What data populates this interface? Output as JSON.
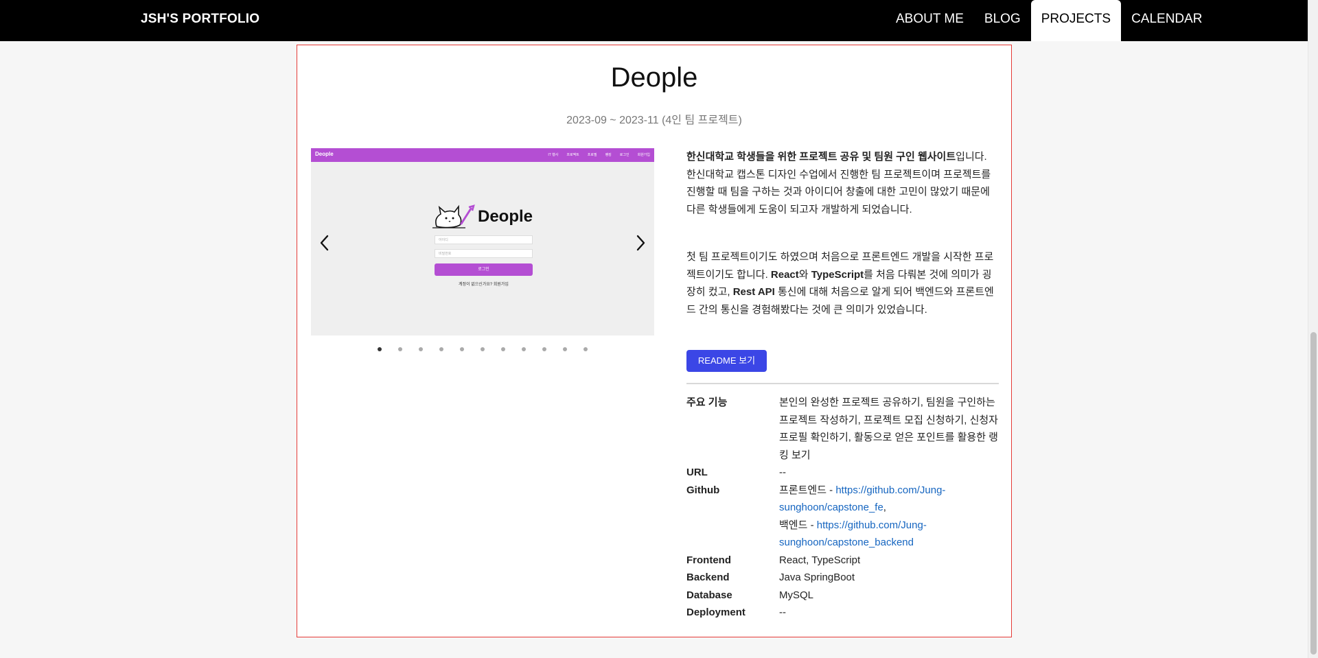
{
  "nav": {
    "brand": "JSH'S PORTFOLIO",
    "items": [
      {
        "label": "ABOUT ME",
        "active": false
      },
      {
        "label": "BLOG",
        "active": false
      },
      {
        "label": "PROJECTS",
        "active": true
      },
      {
        "label": "CALENDAR",
        "active": false
      }
    ]
  },
  "project": {
    "title": "Deople",
    "period": "2023-09 ~ 2023-11 (4인 팀 프로젝트)",
    "carousel": {
      "slide_count": 11,
      "active_index": 0,
      "screenshot": {
        "logo": "Deople",
        "menu": [
          "IT 행사",
          "프로젝트",
          "프로필",
          "랭킹",
          "로그인",
          "회원가입"
        ],
        "brand": "Deople",
        "id_placeholder": "아이디",
        "pw_placeholder": "비밀번호",
        "login_label": "로그인",
        "signup_text": "계정이 없으신가요? 회원가입",
        "accent_color": "#b44ed3"
      }
    },
    "description": {
      "p1_bold": "한신대학교 학생들을 위한 프로젝트 공유 및 팀원 구인 웹사이트",
      "p1_rest": "입니다. 한신대학교 캡스톤 디자인 수업에서 진행한 팀 프로젝트이며 프로젝트를 진행할 때 팀을 구하는 것과 아이디어 창출에 대한 고민이 많았기 때문에 다른 학생들에게 도움이 되고자 개발하게 되었습니다.",
      "p2_a": "첫 팀 프로젝트이기도 하였으며 처음으로 프론트엔드 개발을 시작한 프로젝트이기도 합니다. ",
      "p2_react": "React",
      "p2_b": "와 ",
      "p2_ts": "TypeScript",
      "p2_c": "를 처음 다뤄본 것에 의미가 굉장히 컸고, ",
      "p2_rest": "Rest API",
      "p2_d": " 통신에 대해 처음으로 알게 되어 백엔드와 프론트엔드 간의 통신을 경험해봤다는 것에 큰 의미가 있었습니다."
    },
    "readme_label": "README 보기",
    "info": {
      "features_key": "주요 기능",
      "features_val": "본인의 완성한 프로젝트 공유하기, 팀원을 구인하는 프로젝트 작성하기, 프로젝트 모집 신청하기, 신청자 프로필 확인하기, 활동으로 얻은 포인트를 활용한 랭킹 보기",
      "url_key": "URL",
      "url_val": "--",
      "github_key": "Github",
      "github_fe_prefix": "프론트엔드 - ",
      "github_fe_link": "https://github.com/Jung-sunghoon/capstone_fe",
      "github_fe_suffix": ",",
      "github_be_prefix": "백엔드 - ",
      "github_be_link": "https://github.com/Jung-sunghoon/capstone_backend",
      "frontend_key": "Frontend",
      "frontend_val": "React, TypeScript",
      "backend_key": "Backend",
      "backend_val": "Java SpringBoot",
      "database_key": "Database",
      "database_val": "MySQL",
      "deployment_key": "Deployment",
      "deployment_val": "--"
    }
  },
  "colors": {
    "nav_bg": "#000000",
    "card_border": "#e53935",
    "button": "#3b46e6",
    "link": "#1565c0"
  }
}
